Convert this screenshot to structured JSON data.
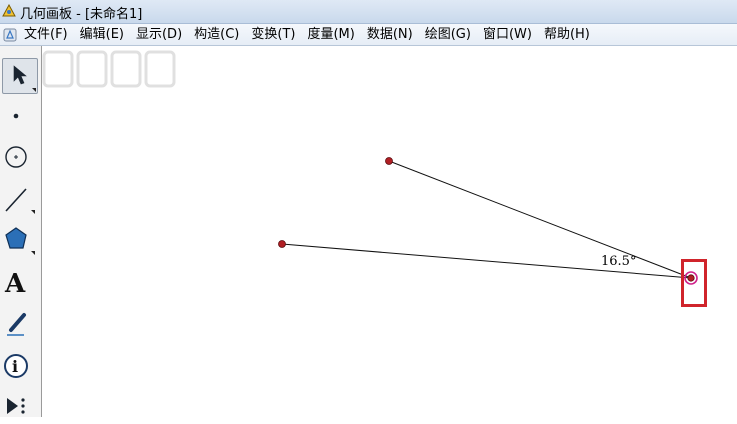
{
  "window": {
    "title": "几何画板 - [未命名1]"
  },
  "menu": {
    "items": [
      {
        "label": "文件(F)"
      },
      {
        "label": "编辑(E)"
      },
      {
        "label": "显示(D)"
      },
      {
        "label": "构造(C)"
      },
      {
        "label": "变换(T)"
      },
      {
        "label": "度量(M)"
      },
      {
        "label": "数据(N)"
      },
      {
        "label": "绘图(G)"
      },
      {
        "label": "窗口(W)"
      },
      {
        "label": "帮助(H)"
      }
    ]
  },
  "toolbar": {
    "tools": [
      {
        "icon": "arrow-select-icon",
        "selected": true
      },
      {
        "icon": "point-tool-icon"
      },
      {
        "icon": "compass-tool-icon"
      },
      {
        "icon": "straightedge-tool-icon"
      },
      {
        "icon": "polygon-tool-icon"
      },
      {
        "icon": "text-tool-icon",
        "glyph": "A"
      },
      {
        "icon": "marker-tool-icon"
      },
      {
        "icon": "information-tool-icon",
        "glyph": "i"
      },
      {
        "icon": "custom-tool-icon"
      }
    ]
  },
  "canvas": {
    "angle_measure": "16.5°",
    "point_color": "#b01e23",
    "selected_point_color": "#d0208a",
    "highlight_color": "#d0242b"
  }
}
